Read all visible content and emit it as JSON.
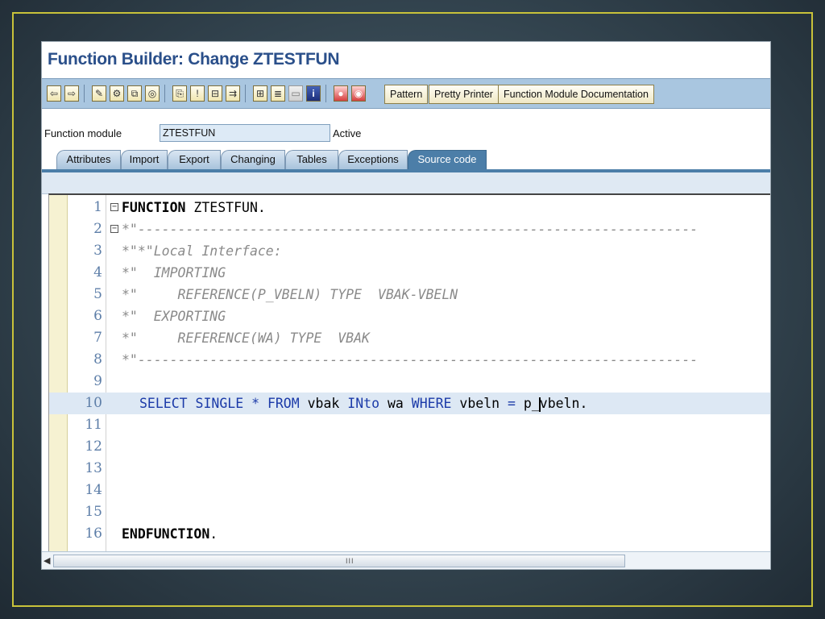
{
  "window": {
    "title": "Function Builder: Change ZTESTFUN"
  },
  "toolbar": {
    "pattern_label": "Pattern",
    "pretty_printer_label": "Pretty Printer",
    "documentation_label": "Function Module Documentation"
  },
  "function_module": {
    "label": "Function module",
    "value": "ZTESTFUN",
    "status": "Active"
  },
  "tabs": [
    {
      "label": "Attributes"
    },
    {
      "label": "Import"
    },
    {
      "label": "Export"
    },
    {
      "label": "Changing"
    },
    {
      "label": "Tables"
    },
    {
      "label": "Exceptions"
    },
    {
      "label": "Source code",
      "active": true
    }
  ],
  "editor": {
    "lines": [
      {
        "no": "1",
        "text_kw": "FUNCTION",
        "text_rest": " ZTESTFUN."
      },
      {
        "no": "2",
        "text": "*\"----------------------------------------------------------------------"
      },
      {
        "no": "3",
        "text": "*\"*\"Local Interface:"
      },
      {
        "no": "4",
        "text": "*\"  IMPORTING"
      },
      {
        "no": "5",
        "text": "*\"     REFERENCE(P_VBELN) TYPE  VBAK-VBELN"
      },
      {
        "no": "6",
        "text": "*\"  EXPORTING"
      },
      {
        "no": "7",
        "text": "*\"     REFERENCE(WA) TYPE  VBAK"
      },
      {
        "no": "8",
        "text": "*\"----------------------------------------------------------------------"
      },
      {
        "no": "9",
        "text": ""
      },
      {
        "no": "10",
        "t1": "SELECT SINGLE * FROM",
        "t2": " vbak ",
        "t3": "INto",
        "t4": " wa ",
        "t5": "WHERE",
        "t6": " vbeln ",
        "t7": "=",
        "t8": " p_",
        "t9": "vbeln",
        "t10": "."
      },
      {
        "no": "11",
        "text": ""
      },
      {
        "no": "12",
        "text": ""
      },
      {
        "no": "13",
        "text": ""
      },
      {
        "no": "14",
        "text": ""
      },
      {
        "no": "15",
        "text": ""
      },
      {
        "no": "16",
        "text_kw": "ENDFUNCTION",
        "text_rest": "."
      }
    ]
  },
  "scrollbar": {
    "grip": "III"
  }
}
